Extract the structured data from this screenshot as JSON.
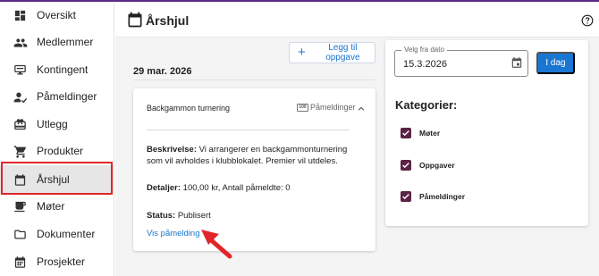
{
  "sidebar": {
    "items": [
      {
        "label": "Oversikt",
        "icon": "dashboard-icon"
      },
      {
        "label": "Medlemmer",
        "icon": "people-icon"
      },
      {
        "label": "Kontingent",
        "icon": "payment-terminal-icon"
      },
      {
        "label": "Påmeldinger",
        "icon": "person-check-icon"
      },
      {
        "label": "Utlegg",
        "icon": "receipt-icon"
      },
      {
        "label": "Produkter",
        "icon": "shopping-cart-icon"
      },
      {
        "label": "Årshjul",
        "icon": "calendar-icon"
      },
      {
        "label": "Møter",
        "icon": "coffee-icon"
      },
      {
        "label": "Dokumenter",
        "icon": "folder-icon"
      },
      {
        "label": "Prosjekter",
        "icon": "grid-calendar-icon"
      }
    ],
    "active": "Årshjul"
  },
  "header": {
    "title": "Årshjul",
    "help_icon": "help-icon"
  },
  "toolbar": {
    "add_label": "Legg til oppgave"
  },
  "event_list": {
    "date": "29 mar. 2026",
    "event": {
      "title": "Backgammon turnering",
      "badge": "Påmeldinger",
      "description_label": "Beskrivelse:",
      "description": "Vi arrangerer en backgammonturnering som vil avholdes i klubblokalet. Premier vil utdeles.",
      "details_label": "Detaljer:",
      "details": "100,00 kr, Antall påmeldte: 0",
      "status_label": "Status:",
      "status": "Publisert",
      "link": "Vis påmelding"
    }
  },
  "filter": {
    "date_label": "Velg fra dato",
    "date_value": "15.3.2026",
    "today_label": "I dag",
    "categories_title": "Kategorier:",
    "categories": [
      {
        "label": "Møter",
        "checked": true
      },
      {
        "label": "Oppgaver",
        "checked": true
      },
      {
        "label": "Påmeldinger",
        "checked": true
      }
    ]
  },
  "colors": {
    "accent": "#1976d2",
    "checkbox": "#5b2346",
    "highlight_outline": "#e0262a",
    "arrow": "#e0262a"
  }
}
